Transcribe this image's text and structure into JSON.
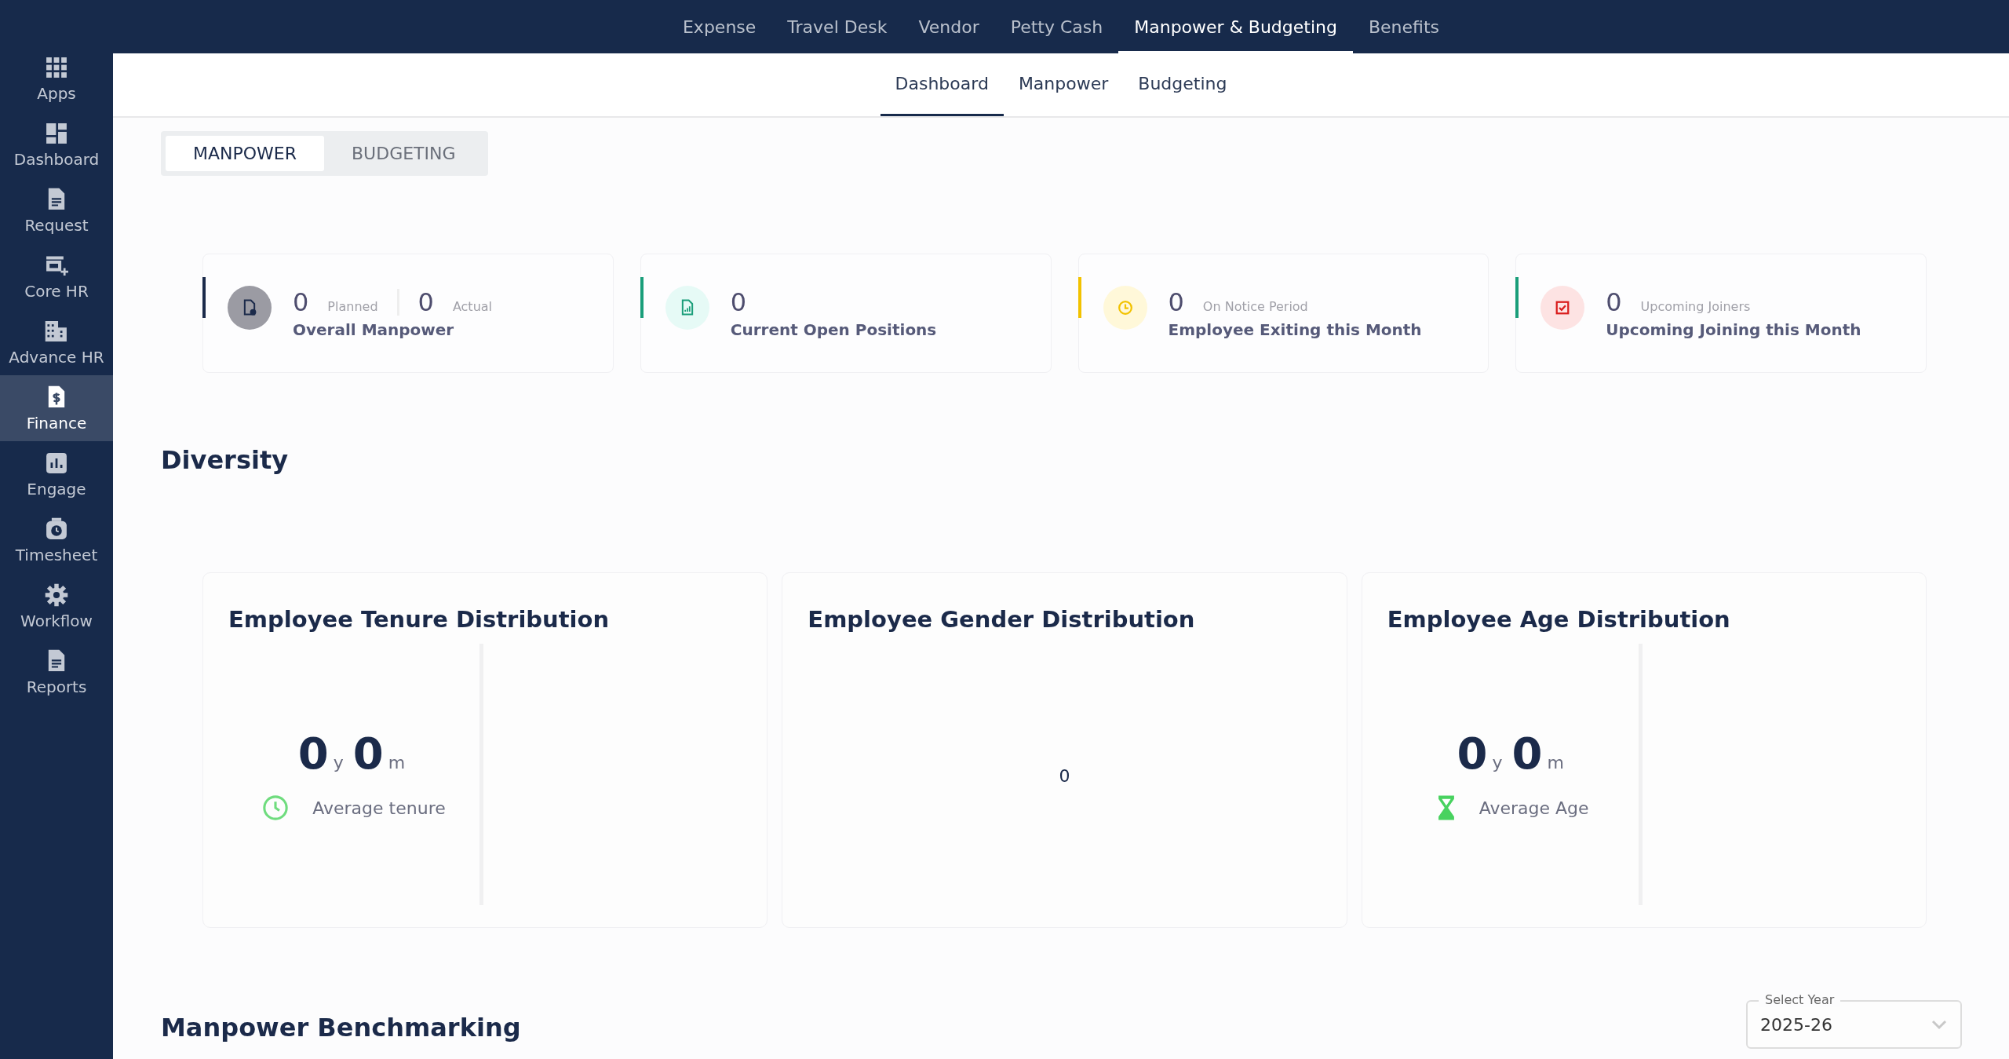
{
  "sidebar": {
    "items": [
      {
        "label": "Apps",
        "selected": false
      },
      {
        "label": "Dashboard",
        "selected": false
      },
      {
        "label": "Request",
        "selected": false
      },
      {
        "label": "Core HR",
        "selected": false
      },
      {
        "label": "Advance HR",
        "selected": false
      },
      {
        "label": "Finance",
        "selected": true
      },
      {
        "label": "Engage",
        "selected": false
      },
      {
        "label": "Timesheet",
        "selected": false
      },
      {
        "label": "Workflow",
        "selected": false
      },
      {
        "label": "Reports",
        "selected": false
      }
    ]
  },
  "top_nav": {
    "items": [
      {
        "label": "Expense",
        "selected": false
      },
      {
        "label": "Travel Desk",
        "selected": false
      },
      {
        "label": "Vendor",
        "selected": false
      },
      {
        "label": "Petty Cash",
        "selected": false
      },
      {
        "label": "Manpower & Budgeting",
        "selected": true
      },
      {
        "label": "Benefits",
        "selected": false
      }
    ]
  },
  "sub_tabs": [
    {
      "label": "Dashboard",
      "selected": true
    },
    {
      "label": "Manpower",
      "selected": false
    },
    {
      "label": "Budgeting",
      "selected": false
    }
  ],
  "toggle": [
    {
      "label": "MANPOWER",
      "selected": true
    },
    {
      "label": "BUDGETING",
      "selected": false
    }
  ],
  "stats": [
    {
      "kind": "split",
      "color": "#1b2a4a",
      "value": "0",
      "caption": "Planned",
      "value_2": "0",
      "caption_2": "Actual",
      "title": "Overall Manpower"
    },
    {
      "kind": "single",
      "color": "#1a9e7a",
      "value": "0",
      "title": "Current Open Positions"
    },
    {
      "kind": "captioned",
      "color": "#f2c200",
      "value": "0",
      "caption": "On Notice Period",
      "title": "Employee Exiting this Month"
    },
    {
      "kind": "captioned",
      "color": "#1a9e7a",
      "value": "0",
      "caption": "Upcoming Joiners",
      "title": "Upcoming Joining this Month"
    }
  ],
  "diversity": {
    "heading": "Diversity",
    "cards": [
      {
        "kind": "duration",
        "title": "Employee Tenure Distribution",
        "years": "0",
        "year_unit": "y",
        "months": "0",
        "month_unit": "m",
        "caption": "Average tenure"
      },
      {
        "kind": "number",
        "title": "Employee Gender Distribution",
        "value": "0"
      },
      {
        "kind": "duration",
        "title": "Employee Age Distribution",
        "years": "0",
        "year_unit": "y",
        "months": "0",
        "month_unit": "m",
        "caption": "Average Age"
      }
    ]
  },
  "benchmarking": {
    "heading": "Manpower Benchmarking",
    "year_select": {
      "label": "Select Year",
      "value": "2025-26"
    }
  }
}
